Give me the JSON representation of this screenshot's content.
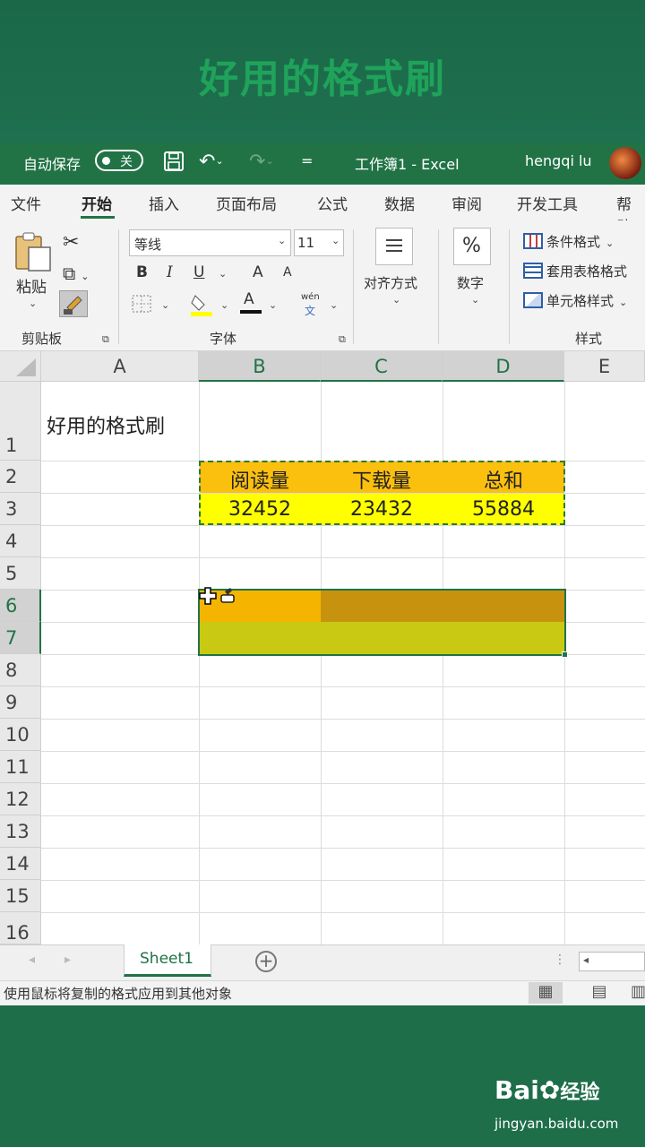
{
  "banner": {
    "title": "好用的格式刷"
  },
  "titlebar": {
    "autosave_label": "自动保存",
    "autosave_state": "关",
    "workbook": "工作簿1  -  Excel",
    "user": "hengqi lu"
  },
  "tabs": [
    "文件",
    "开始",
    "插入",
    "页面布局",
    "公式",
    "数据",
    "审阅",
    "开发工具",
    "帮助"
  ],
  "ribbon": {
    "paste_label": "粘贴",
    "clipboard_group": "剪贴板",
    "font_name": "等线",
    "font_size": "11",
    "bold": "B",
    "italic": "I",
    "underline": "U",
    "grow_font": "A",
    "shrink_font": "A",
    "font_color": "A",
    "phonetic": "wén",
    "phonetic_sub": "文",
    "font_group": "字体",
    "align_label": "对齐方式",
    "number_label": "数字",
    "number_symbol": "%",
    "conditional_format": "条件格式",
    "table_format": "套用表格格式",
    "cell_styles": "单元格样式",
    "styles_group": "样式"
  },
  "grid": {
    "columns": [
      "A",
      "B",
      "C",
      "D",
      "E"
    ],
    "rows": [
      "1",
      "2",
      "3",
      "4",
      "5",
      "6",
      "7",
      "8",
      "9",
      "10",
      "11",
      "12",
      "13",
      "14",
      "15",
      "16"
    ],
    "a1_text": "好用的格式刷",
    "headers": [
      "阅读量",
      "下载量",
      "总和"
    ],
    "values": [
      "32452",
      "23432",
      "55884"
    ],
    "colors": {
      "header_fill": "#fbbf0e",
      "value_fill": "#ffff00",
      "b6_fill": "#f4b400",
      "cd6_fill": "#c7930f",
      "row7_fill": "#c9c914",
      "accent": "#217346"
    }
  },
  "sheet_tabs": {
    "active": "Sheet1"
  },
  "status": {
    "message": "使用鼠标将复制的格式应用到其他对象"
  },
  "watermark": {
    "brand": "Bai",
    "brand_cn": "经验",
    "url": "jingyan.baidu.com"
  }
}
